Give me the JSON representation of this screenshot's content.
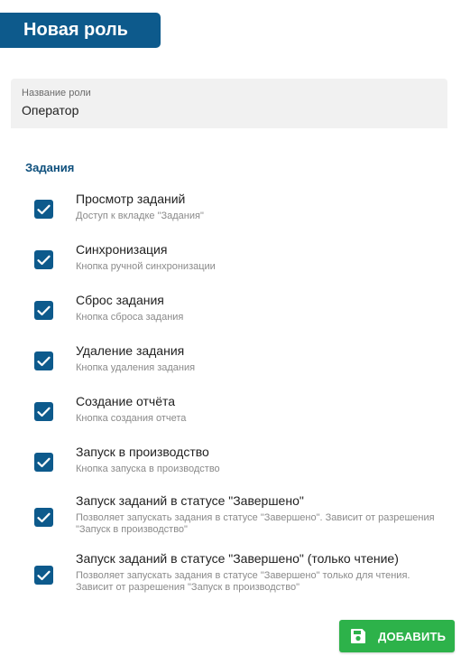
{
  "header": {
    "title": "Новая роль"
  },
  "role_name": {
    "label": "Название роли",
    "value": "Оператор"
  },
  "section": {
    "title": "Задания"
  },
  "permissions": [
    {
      "title": "Просмотр заданий",
      "description": "Доступ к вкладке \"Задания\"",
      "checked": true
    },
    {
      "title": "Синхронизация",
      "description": "Кнопка ручной синхронизации",
      "checked": true
    },
    {
      "title": "Сброс задания",
      "description": "Кнопка сброса задания",
      "checked": true
    },
    {
      "title": "Удаление задания",
      "description": "Кнопка удаления задания",
      "checked": true
    },
    {
      "title": "Создание отчёта",
      "description": "Кнопка создания отчета",
      "checked": true
    },
    {
      "title": "Запуск в производство",
      "description": "Кнопка запуска в производство",
      "checked": true
    },
    {
      "title": "Запуск заданий в статусе \"Завершено\"",
      "description": "Позволяет запускать задания в статусе \"Завершено\". Зависит от разрешения \"Запуск в производство\"",
      "checked": true
    },
    {
      "title": "Запуск заданий в статусе \"Завершено\" (только чтение)",
      "description": "Позволяет запускать задания в статусе \"Завершено\" только для чтения. Зависит от разрешения \"Запуск в производство\"",
      "checked": true
    }
  ],
  "actions": {
    "add_label": "ДОБАВИТЬ",
    "add_icon": "save-icon"
  },
  "colors": {
    "primary": "#0d5a8c",
    "success": "#2db24a",
    "section_title": "#0d4f7c"
  }
}
